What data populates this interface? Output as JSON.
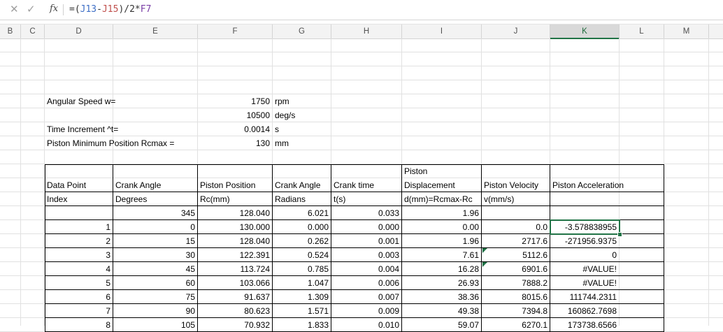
{
  "formula_bar": {
    "cancel_icon": "✕",
    "enter_icon": "✓",
    "fx_label": "fx",
    "formula_parts": [
      "=(",
      "J13",
      "-",
      "J15",
      ")/2*",
      "F7"
    ]
  },
  "columns": [
    "B",
    "C",
    "D",
    "E",
    "F",
    "G",
    "H",
    "I",
    "J",
    "K",
    "L",
    "M"
  ],
  "selected_column": "K",
  "params": [
    {
      "label": "Angular Speed w=",
      "value": "1750",
      "unit": "rpm"
    },
    {
      "label": "",
      "value": "10500",
      "unit": "deg/s"
    },
    {
      "label": "Time Increment ^t=",
      "value": "0.0014",
      "unit": "s"
    },
    {
      "label": "Piston Minimum Position Rcmax =",
      "value": "130",
      "unit": "mm"
    }
  ],
  "table": {
    "header_top": {
      "I": "Piston"
    },
    "header_row1": [
      "Data Point",
      "Crank Angle",
      "Piston Position",
      "Crank Angle",
      "Crank time",
      "Displacement",
      "Piston Velocity",
      "Piston Acceleration"
    ],
    "header_row2": [
      "Index",
      "Degrees",
      "Rc(mm)",
      "Radians",
      "t(s)",
      "d(mm)=Rcmax-Rc",
      "v(mm/s)",
      ""
    ],
    "rows": [
      [
        "",
        "345",
        "128.040",
        "6.021",
        "0.033",
        "1.96",
        "",
        ""
      ],
      [
        "1",
        "0",
        "130.000",
        "0.000",
        "0.000",
        "0.00",
        "0.0",
        "-3.578838955"
      ],
      [
        "2",
        "15",
        "128.040",
        "0.262",
        "0.001",
        "1.96",
        "2717.6",
        "-271956.9375"
      ],
      [
        "3",
        "30",
        "122.391",
        "0.524",
        "0.003",
        "7.61",
        "5112.6",
        "0"
      ],
      [
        "4",
        "45",
        "113.724",
        "0.785",
        "0.004",
        "16.28",
        "6901.6",
        "#VALUE!"
      ],
      [
        "5",
        "60",
        "103.066",
        "1.047",
        "0.006",
        "26.93",
        "7888.2",
        "#VALUE!"
      ],
      [
        "6",
        "75",
        "91.637",
        "1.309",
        "0.007",
        "38.36",
        "8015.6",
        "111744.2311"
      ],
      [
        "7",
        "90",
        "80.623",
        "1.571",
        "0.009",
        "49.38",
        "7394.8",
        "160862.7698"
      ],
      [
        "8",
        "105",
        "70.932",
        "1.833",
        "0.010",
        "59.07",
        "6270.1",
        "173738.6566"
      ]
    ]
  }
}
